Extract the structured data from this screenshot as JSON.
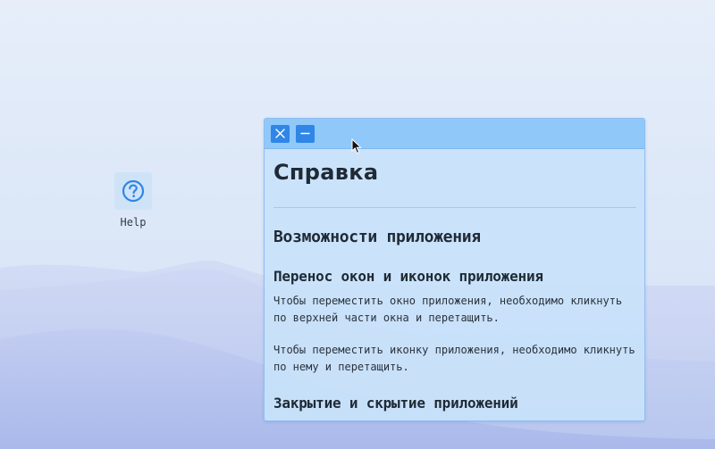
{
  "desktop": {
    "icons": [
      {
        "label": "Help",
        "icon": "question-circle-icon"
      }
    ]
  },
  "window": {
    "controls": {
      "close": "close-icon",
      "minimize": "minimize-icon"
    },
    "content": {
      "title": "Справка",
      "section_title": "Возможности приложения",
      "move_heading": "Перенос окон и иконок приложения",
      "move_para_1": "Чтобы переместить окно приложения, необходимо кликнуть по верхней части окна и перетащить.",
      "move_para_2": "Чтобы переместить иконку приложения, необходимо кликнуть по нему и перетащить.",
      "close_heading": "Закрытие и скрытие приложений"
    }
  },
  "colors": {
    "titlebar": "#90c8fa",
    "button": "#2f86e6",
    "window_bg": "#c8e2fa"
  }
}
